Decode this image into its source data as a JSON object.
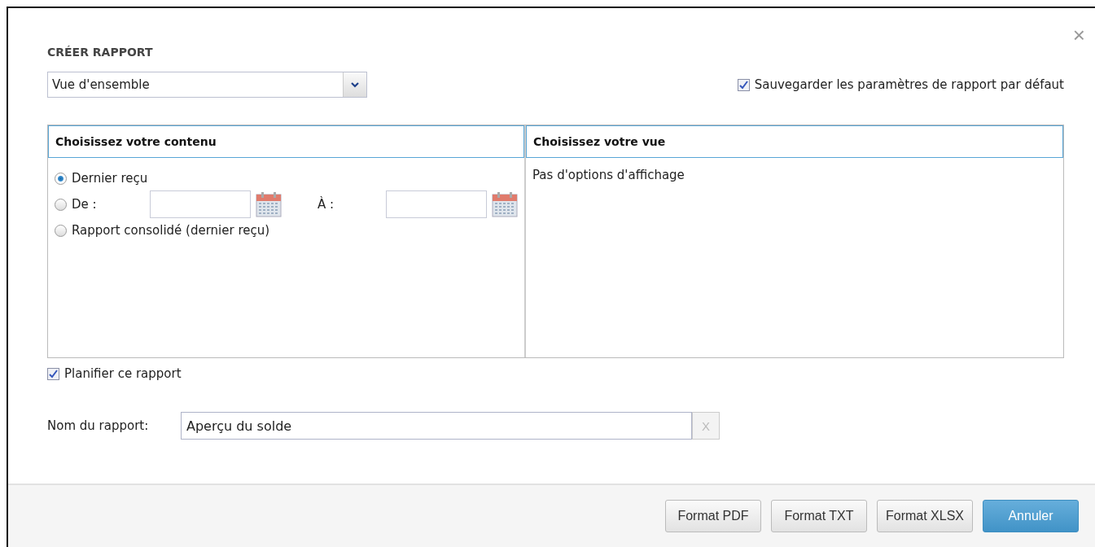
{
  "dialog": {
    "title": "CRÉER RAPPORT",
    "close": "×"
  },
  "report_type": {
    "value": "Vue d'ensemble"
  },
  "save_defaults": {
    "label": "Sauvegarder les paramètres de rapport par défaut",
    "checked": true
  },
  "content_panel": {
    "heading": "Choisissez votre contenu",
    "options": [
      {
        "kind": "plain",
        "label": "Dernier reçu",
        "selected": true
      },
      {
        "kind": "range",
        "label": "De :",
        "to_label": "À :",
        "selected": false
      },
      {
        "kind": "plain",
        "label": "Rapport consolidé (dernier reçu)",
        "selected": false
      }
    ]
  },
  "view_panel": {
    "heading": "Choisissez votre vue",
    "message": "Pas d'options d'affichage"
  },
  "schedule": {
    "label": "Planifier ce rapport",
    "checked": true
  },
  "report_name": {
    "label": "Nom du rapport:",
    "value": "Aperçu du solde",
    "clear": "X"
  },
  "buttons": [
    {
      "label": "Format PDF",
      "kind": "default"
    },
    {
      "label": "Format TXT",
      "kind": "default"
    },
    {
      "label": "Format XLSX",
      "kind": "default"
    },
    {
      "label": "Annuler",
      "kind": "primary"
    }
  ]
}
